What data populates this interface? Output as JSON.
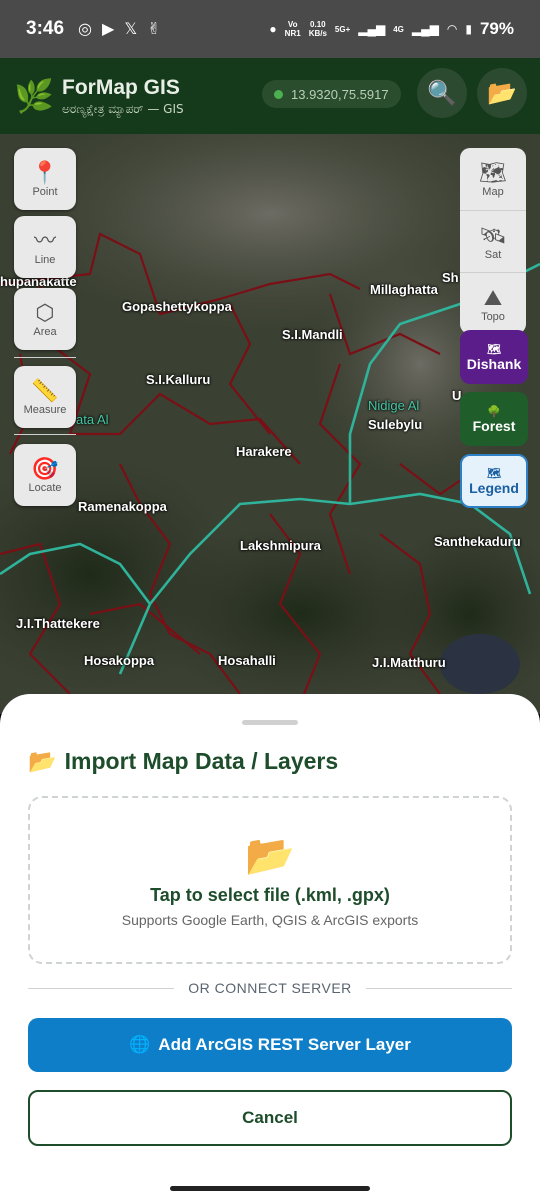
{
  "status": {
    "time": "3:46",
    "net_volte": "Vo\nNR1",
    "net_speed": "0.10\nKB/s",
    "net_5g": "5G+",
    "net_4g": "4G",
    "battery": "79%"
  },
  "header": {
    "title": "ForMap GIS",
    "subtitle": "ಅರಣ್ಯಕ್ಷೇತ್ರ ಮ್ಯಾಪರ್ — GIS",
    "coords": "13.9320,75.5917",
    "search_icon": "search-icon",
    "folder_icon": "folder-icon"
  },
  "tools": [
    {
      "label": "Point",
      "icon": "📍"
    },
    {
      "label": "Line",
      "icon": "〰"
    },
    {
      "label": "Area",
      "icon": "⬡"
    },
    {
      "label": "Measure",
      "icon": "📏"
    },
    {
      "label": "Locate",
      "icon": "🎯"
    }
  ],
  "basemaps": [
    {
      "label": "Map",
      "icon": "🗺"
    },
    {
      "label": "Sat",
      "icon": "🛰"
    },
    {
      "label": "Topo",
      "icon": "⛰"
    }
  ],
  "layers": {
    "dishank": "Dishank",
    "forest": "Forest",
    "legend": "Legend"
  },
  "places": [
    "hupanakatte",
    "Gopashettykoppa",
    "Millaghatta",
    "S.I.Mandli",
    "S.I.Kalluru",
    "ata Al",
    "Nidige Al",
    "Sulebylu",
    "Harakere",
    "Ramenakoppa",
    "Lakshmipura",
    "Santhekaduru",
    "J.I.Thattekere",
    "Hosakoppa",
    "Hosahalli",
    "J.I.Matthuru",
    "Sh",
    "U"
  ],
  "sheet": {
    "title": "Import Map Data / Layers",
    "drop_title": "Tap to select file (.kml, .gpx)",
    "drop_sub": "Supports Google Earth, QGIS & ArcGIS exports",
    "divider": "OR CONNECT SERVER",
    "arcgis_button": "Add ArcGIS REST Server Layer",
    "cancel_button": "Cancel"
  },
  "colors": {
    "brand_green": "#1e4d2b",
    "header_bg": "#14391b",
    "primary_blue": "#0f7ec9",
    "dishank_purple": "#5b1d8a",
    "forest_green": "#1f5e2a",
    "boundary_red": "#7a0f16",
    "boundary_teal": "#2fb39a"
  }
}
